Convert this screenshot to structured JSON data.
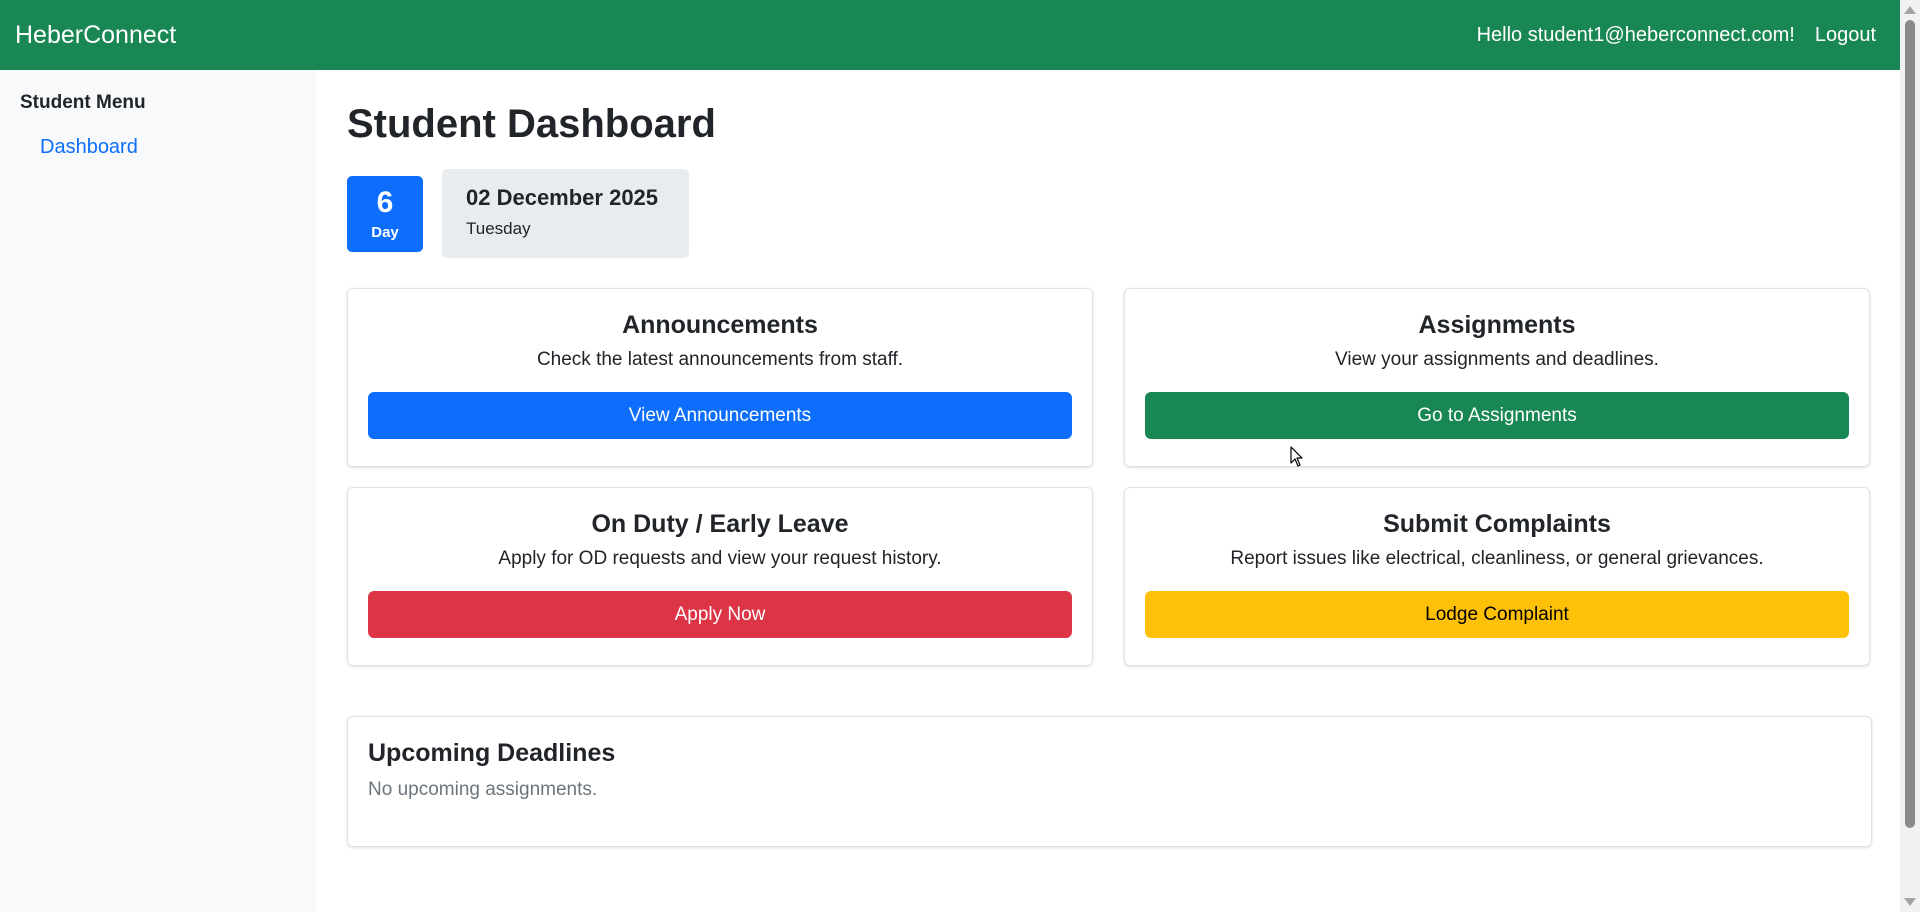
{
  "navbar": {
    "brand": "HeberConnect",
    "greeting": "Hello student1@heberconnect.com!",
    "logout_label": "Logout",
    "color": "#198754"
  },
  "sidebar": {
    "heading": "Student Menu",
    "items": [
      {
        "label": "Dashboard"
      }
    ]
  },
  "main": {
    "title": "Student Dashboard",
    "day": {
      "number": "6",
      "label": "Day"
    },
    "date": {
      "full": "02 December 2025",
      "weekday": "Tuesday"
    },
    "cards": [
      {
        "title": "Announcements",
        "description": "Check the latest announcements from staff.",
        "button_label": "View Announcements",
        "button_color": "#0d6efd"
      },
      {
        "title": "Assignments",
        "description": "View your assignments and deadlines.",
        "button_label": "Go to Assignments",
        "button_color": "#198754"
      },
      {
        "title": "On Duty / Early Leave",
        "description": "Apply for OD requests and view your request history.",
        "button_label": "Apply Now",
        "button_color": "#dc3545"
      },
      {
        "title": "Submit Complaints",
        "description": "Report issues like electrical, cleanliness, or general grievances.",
        "button_label": "Lodge Complaint",
        "button_color": "#ffc107"
      }
    ],
    "deadlines": {
      "title": "Upcoming Deadlines",
      "empty_text": "No upcoming assignments."
    }
  }
}
